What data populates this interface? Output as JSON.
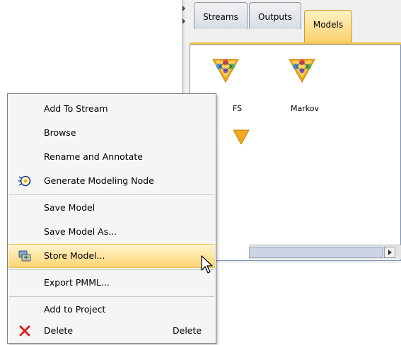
{
  "tabs": [
    {
      "label": "Streams",
      "active": false
    },
    {
      "label": "Outputs",
      "active": false
    },
    {
      "label": "Models",
      "active": true
    }
  ],
  "models": [
    {
      "label": "FS",
      "icon": "model-nugget-icon"
    },
    {
      "label": "Markov",
      "icon": "model-nugget-icon"
    }
  ],
  "context_menu": {
    "items": [
      {
        "label": "Add To Stream",
        "icon": null
      },
      {
        "label": "Browse",
        "icon": null
      },
      {
        "label": "Rename and Annotate",
        "icon": null
      },
      {
        "label": "Generate Modeling Node",
        "icon": "generate-node-icon"
      },
      {
        "label": "Save Model",
        "icon": null
      },
      {
        "label": "Save Model As...",
        "icon": null
      },
      {
        "label": "Store Model...",
        "icon": "store-model-icon",
        "highlighted": true
      },
      {
        "label": "Export PMML...",
        "icon": null
      },
      {
        "label": "Add to Project",
        "icon": null
      },
      {
        "label": "Delete",
        "icon": "delete-icon",
        "shortcut": "Delete"
      }
    ]
  },
  "colors": {
    "highlight": "#fbd56f",
    "active_tab": "#f8cf6a",
    "panel_border": "#7a95b8",
    "delete_icon": "#e02020"
  }
}
